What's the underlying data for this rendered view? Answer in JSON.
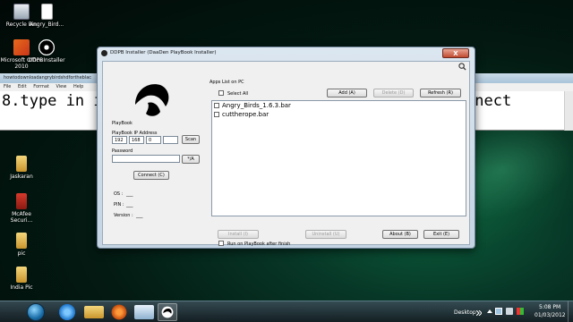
{
  "desktop": {
    "icons": [
      {
        "label": "Recycle Bin"
      },
      {
        "label": "Angry_Bird..."
      },
      {
        "label": "Microsoft Office 2010"
      },
      {
        "label": "DDPBInstaller"
      },
      {
        "label": "songs"
      },
      {
        "label": "Jaskaran"
      },
      {
        "label": "McAfee Securi..."
      },
      {
        "label": "pic"
      },
      {
        "label": "India Pic"
      }
    ]
  },
  "notepad": {
    "title": "howtodownloadangrybirdshdfortheblac",
    "menu": [
      "File",
      "Edit",
      "Format",
      "View",
      "Help"
    ],
    "text_left": "8.type in i",
    "text_right": "nnect"
  },
  "dialog": {
    "title": "DDPB Installer (DaaDen PlayBook Installer)",
    "close_label": "X",
    "playbook_label": "PlayBook",
    "ip_label": "PlayBook IP Address",
    "ip": [
      "192",
      "168",
      "0",
      ""
    ],
    "scan_label": "Scan",
    "password_label": "Password",
    "password_toggle": "*/A",
    "connect_label": "Connect (C)",
    "os_label": "OS :",
    "os_value": "___",
    "pin_label": "PIN :",
    "pin_value": "___",
    "version_label": "Version :",
    "version_value": "___",
    "apps_group_label": "Apps List on PC",
    "select_all_label": "Select All",
    "add_label": "Add (A)",
    "delete_label": "Delete (D)",
    "refresh_label": "Refresh (R)",
    "apps": [
      {
        "name": "Angry_Birds_1.6.3.bar"
      },
      {
        "name": "cuttherope.bar"
      }
    ],
    "install_label": "Install (I)",
    "uninstall_label": "Uninstall (U)",
    "about_label": "About (B)",
    "exit_label": "Exit (E)",
    "run_after_label": "Run on PlayBook after finish"
  },
  "taskbar": {
    "desktop_label": "Desktop",
    "time": "5:08 PM",
    "date": "01/03/2012"
  }
}
